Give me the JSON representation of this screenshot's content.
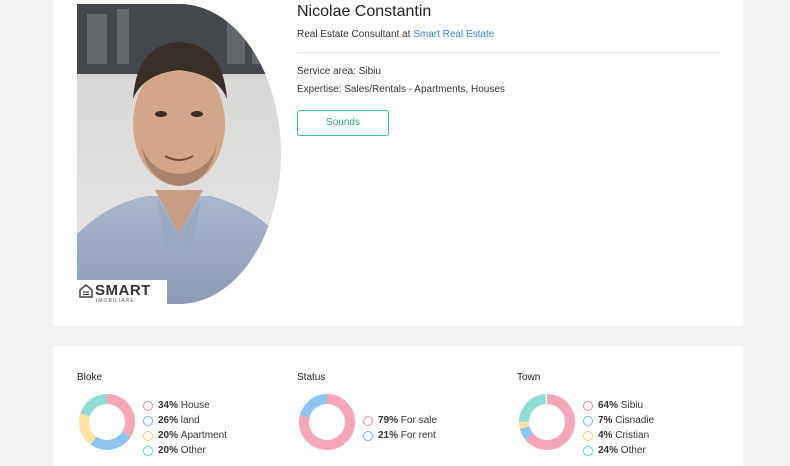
{
  "profile": {
    "name": "Nicolae Constantin",
    "role_prefix": "Real Estate Consultant at",
    "agency": "Smart Real Estate",
    "service_area_label": "Service area:",
    "service_area": "Sibiu",
    "expertise_label": "Expertise:",
    "expertise": "Sales/Rentals - Apartments, Houses",
    "sounds_label": "Sounds",
    "logo_text": "SMART",
    "logo_sub": "IMOBILIARE"
  },
  "stats": {
    "bloke": {
      "title": "Bloke",
      "items": [
        {
          "pct": "34%",
          "label": "House",
          "color": "#f7a6b7"
        },
        {
          "pct": "26%",
          "label": "land",
          "color": "#8cc6f0"
        },
        {
          "pct": "20%",
          "label": "Apartment",
          "color": "#fde2a0"
        },
        {
          "pct": "20%",
          "label": "Other",
          "color": "#8edcd4"
        }
      ]
    },
    "status": {
      "title": "Status",
      "items": [
        {
          "pct": "79%",
          "label": "For sale",
          "color": "#f7a6b7"
        },
        {
          "pct": "21%",
          "label": "For rent",
          "color": "#8cc6f0"
        }
      ]
    },
    "town": {
      "title": "Town",
      "items": [
        {
          "pct": "64%",
          "label": "Sibiu",
          "color": "#f7a6b7"
        },
        {
          "pct": "7%",
          "label": "Cisnadie",
          "color": "#8cc6f0"
        },
        {
          "pct": "4%",
          "label": "Cristian",
          "color": "#fde2a0"
        },
        {
          "pct": "24%",
          "label": "Other",
          "color": "#8edcd4"
        }
      ]
    }
  },
  "chart_data": [
    {
      "type": "pie",
      "title": "Bloke",
      "categories": [
        "House",
        "land",
        "Apartment",
        "Other"
      ],
      "values": [
        34,
        26,
        20,
        20
      ]
    },
    {
      "type": "pie",
      "title": "Status",
      "categories": [
        "For sale",
        "For rent"
      ],
      "values": [
        79,
        21
      ]
    },
    {
      "type": "pie",
      "title": "Town",
      "categories": [
        "Sibiu",
        "Cisnadie",
        "Cristian",
        "Other"
      ],
      "values": [
        64,
        7,
        4,
        24
      ]
    }
  ]
}
